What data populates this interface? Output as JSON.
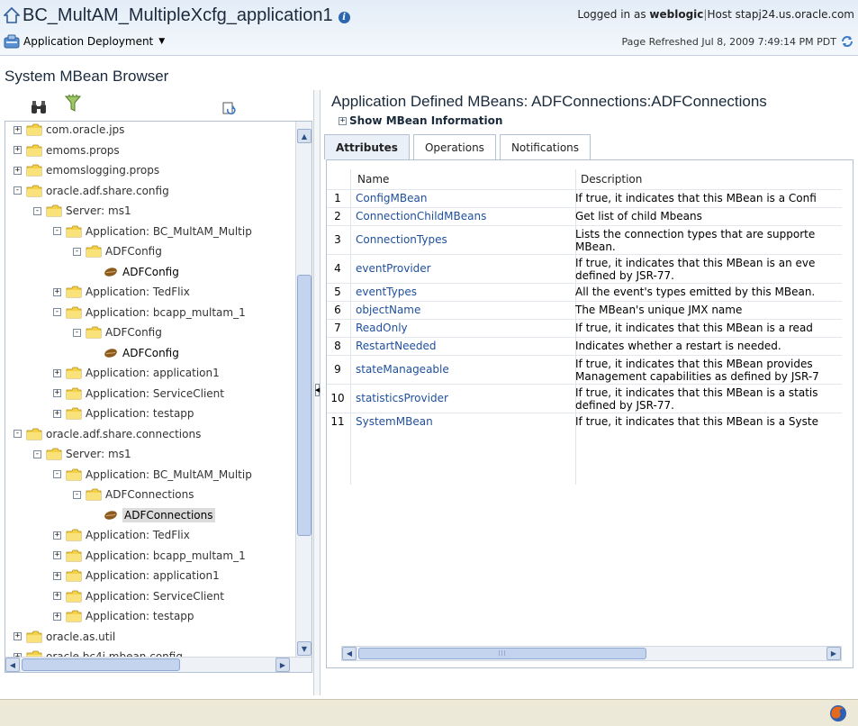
{
  "header": {
    "app_title": "BC_MultAM_MultipleXcfg_application1",
    "target_menu_label": "Application Deployment",
    "login_prefix": "Logged in as",
    "login_user": "weblogic",
    "host_label": "Host stapj24.us.oracle.com",
    "page_refreshed": "Page Refreshed Jul 8, 2009 7:49:14 PM PDT"
  },
  "left": {
    "title": "System MBean Browser",
    "toolbar_icons": [
      "binoculars-icon",
      "filter-icon",
      "refresh-tree-icon"
    ],
    "tree": [
      {
        "label": "com.oracle.jps",
        "indent": 0,
        "type": "folder",
        "toggle": "+"
      },
      {
        "label": "emoms.props",
        "indent": 0,
        "type": "folder",
        "toggle": "+"
      },
      {
        "label": "emomslogging.props",
        "indent": 0,
        "type": "folder",
        "toggle": "+"
      },
      {
        "label": "oracle.adf.share.config",
        "indent": 0,
        "type": "folder",
        "toggle": "-"
      },
      {
        "label": "Server: ms1",
        "indent": 1,
        "type": "folder",
        "toggle": "-"
      },
      {
        "label": "Application: BC_MultAM_Multip",
        "indent": 2,
        "type": "folder",
        "toggle": "-"
      },
      {
        "label": "ADFConfig",
        "indent": 3,
        "type": "folder",
        "toggle": "-"
      },
      {
        "label": "ADFConfig",
        "indent": 4,
        "type": "bean",
        "toggle": ""
      },
      {
        "label": "Application: TedFlix",
        "indent": 2,
        "type": "folder",
        "toggle": "+"
      },
      {
        "label": "Application: bcapp_multam_1",
        "indent": 2,
        "type": "folder",
        "toggle": "-"
      },
      {
        "label": "ADFConfig",
        "indent": 3,
        "type": "folder",
        "toggle": "-"
      },
      {
        "label": "ADFConfig",
        "indent": 4,
        "type": "bean",
        "toggle": ""
      },
      {
        "label": "Application: application1",
        "indent": 2,
        "type": "folder",
        "toggle": "+"
      },
      {
        "label": "Application: ServiceClient",
        "indent": 2,
        "type": "folder",
        "toggle": "+"
      },
      {
        "label": "Application: testapp",
        "indent": 2,
        "type": "folder",
        "toggle": "+"
      },
      {
        "label": "oracle.adf.share.connections",
        "indent": 0,
        "type": "folder",
        "toggle": "-"
      },
      {
        "label": "Server: ms1",
        "indent": 1,
        "type": "folder",
        "toggle": "-"
      },
      {
        "label": "Application: BC_MultAM_Multip",
        "indent": 2,
        "type": "folder",
        "toggle": "-"
      },
      {
        "label": "ADFConnections",
        "indent": 3,
        "type": "folder",
        "toggle": "-"
      },
      {
        "label": "ADFConnections",
        "indent": 4,
        "type": "bean",
        "toggle": "",
        "selected": true
      },
      {
        "label": "Application: TedFlix",
        "indent": 2,
        "type": "folder",
        "toggle": "+"
      },
      {
        "label": "Application: bcapp_multam_1",
        "indent": 2,
        "type": "folder",
        "toggle": "+"
      },
      {
        "label": "Application: application1",
        "indent": 2,
        "type": "folder",
        "toggle": "+"
      },
      {
        "label": "Application: ServiceClient",
        "indent": 2,
        "type": "folder",
        "toggle": "+"
      },
      {
        "label": "Application: testapp",
        "indent": 2,
        "type": "folder",
        "toggle": "+"
      },
      {
        "label": "oracle.as.util",
        "indent": 0,
        "type": "folder",
        "toggle": "+"
      },
      {
        "label": "oracle.bc4j.mbean.config",
        "indent": 0,
        "type": "folder",
        "toggle": "+"
      }
    ]
  },
  "right": {
    "title": "Application Defined MBeans: ADFConnections:ADFConnections",
    "show_info_label": "Show MBean Information",
    "tabs": [
      {
        "label": "Attributes",
        "active": true
      },
      {
        "label": "Operations",
        "active": false
      },
      {
        "label": "Notifications",
        "active": false
      }
    ],
    "columns": {
      "name": "Name",
      "description": "Description"
    },
    "rows": [
      {
        "num": "1",
        "name": "ConfigMBean",
        "desc": "If true, it indicates that this MBean is a Confi"
      },
      {
        "num": "2",
        "name": "ConnectionChildMBeans",
        "desc": "Get list of child Mbeans"
      },
      {
        "num": "3",
        "name": "ConnectionTypes",
        "desc": "Lists the connection types that are supporte MBean."
      },
      {
        "num": "4",
        "name": "eventProvider",
        "desc": "If true, it indicates that this MBean is an eve defined by JSR-77."
      },
      {
        "num": "5",
        "name": "eventTypes",
        "desc": "All the event's types emitted by this MBean."
      },
      {
        "num": "6",
        "name": "objectName",
        "desc": "The MBean's unique JMX name"
      },
      {
        "num": "7",
        "name": "ReadOnly",
        "desc": "If true, it indicates that this MBean is a read"
      },
      {
        "num": "8",
        "name": "RestartNeeded",
        "desc": "Indicates whether a restart is needed."
      },
      {
        "num": "9",
        "name": "stateManageable",
        "desc": "If true, it indicates that this MBean provides Management capabilities as defined by JSR-7"
      },
      {
        "num": "10",
        "name": "statisticsProvider",
        "desc": "If true, it indicates that this MBean is a statis defined by JSR-77."
      },
      {
        "num": "11",
        "name": "SystemMBean",
        "desc": "If true, it indicates that this MBean is a Syste"
      }
    ]
  }
}
